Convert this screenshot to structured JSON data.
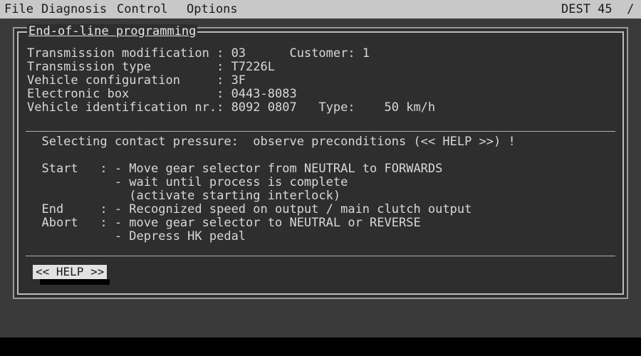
{
  "menu": {
    "file": "File",
    "diagnosis": "Diagnosis",
    "control": "Control",
    "options": "Options",
    "status": "DEST 45  /"
  },
  "panel": {
    "title": "End-of-line programming",
    "info_rows": [
      "Transmission modification : 03      Customer: 1",
      "Transmission type         : T7226L",
      "Vehicle configuration     : 3F",
      "Electronic box            : 0443-8083",
      "Vehicle identification nr.: 8092 0807   Type:    50 km/h"
    ],
    "instruction_rows": [
      "  Selecting contact pressure:  observe preconditions (<< HELP >>) !",
      "",
      "  Start   : - Move gear selector from NEUTRAL to FORWARDS",
      "            - wait until process is complete",
      "              (activate starting interlock)",
      "  End     : - Recognized speed on output / main clutch output",
      "  Abort   : - move gear selector to NEUTRAL or REVERSE",
      "            - Depress HK pedal"
    ],
    "help_button": "<< HELP >>"
  }
}
